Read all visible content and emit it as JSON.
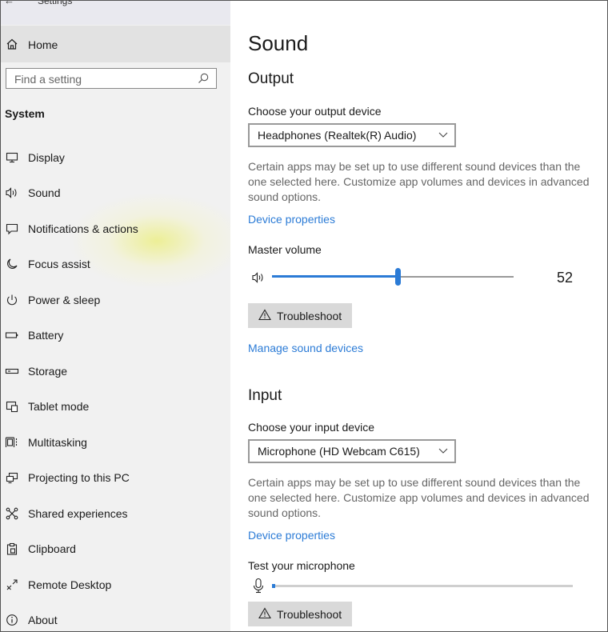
{
  "window": {
    "title": "Settings"
  },
  "sidebar": {
    "home_label": "Home",
    "search_placeholder": "Find a setting",
    "section_label": "System",
    "items": [
      {
        "label": "Display",
        "icon": "monitor-icon"
      },
      {
        "label": "Sound",
        "icon": "speaker-icon"
      },
      {
        "label": "Notifications & actions",
        "icon": "notification-icon"
      },
      {
        "label": "Focus assist",
        "icon": "moon-icon"
      },
      {
        "label": "Power & sleep",
        "icon": "power-icon"
      },
      {
        "label": "Battery",
        "icon": "battery-icon"
      },
      {
        "label": "Storage",
        "icon": "storage-icon"
      },
      {
        "label": "Tablet mode",
        "icon": "tablet-icon"
      },
      {
        "label": "Multitasking",
        "icon": "multitasking-icon"
      },
      {
        "label": "Projecting to this PC",
        "icon": "projector-icon"
      },
      {
        "label": "Shared experiences",
        "icon": "shared-icon"
      },
      {
        "label": "Clipboard",
        "icon": "clipboard-icon"
      },
      {
        "label": "Remote Desktop",
        "icon": "remote-desktop-icon"
      },
      {
        "label": "About",
        "icon": "info-icon"
      }
    ]
  },
  "main": {
    "title": "Sound",
    "output": {
      "heading": "Output",
      "device_label": "Choose your output device",
      "device_value": "Headphones (Realtek(R) Audio)",
      "description": "Certain apps may be set up to use different sound devices than the one selected here. Customize app volumes and devices in advanced sound options.",
      "device_properties_link": "Device properties",
      "volume_label": "Master volume",
      "volume_value": "52",
      "volume_fraction": 0.52,
      "troubleshoot_label": "Troubleshoot",
      "manage_link": "Manage sound devices"
    },
    "input": {
      "heading": "Input",
      "device_label": "Choose your input device",
      "device_value": "Microphone (HD Webcam C615)",
      "description": "Certain apps may be set up to use different sound devices than the one selected here. Customize app volumes and devices in advanced sound options.",
      "device_properties_link": "Device properties",
      "test_label": "Test your microphone",
      "mic_level_fraction": 0.01,
      "troubleshoot_label": "Troubleshoot"
    }
  },
  "colors": {
    "accent": "#2b7bd6",
    "sidebar_bg": "#f1f1f1",
    "button_bg": "#d9d9d9"
  }
}
